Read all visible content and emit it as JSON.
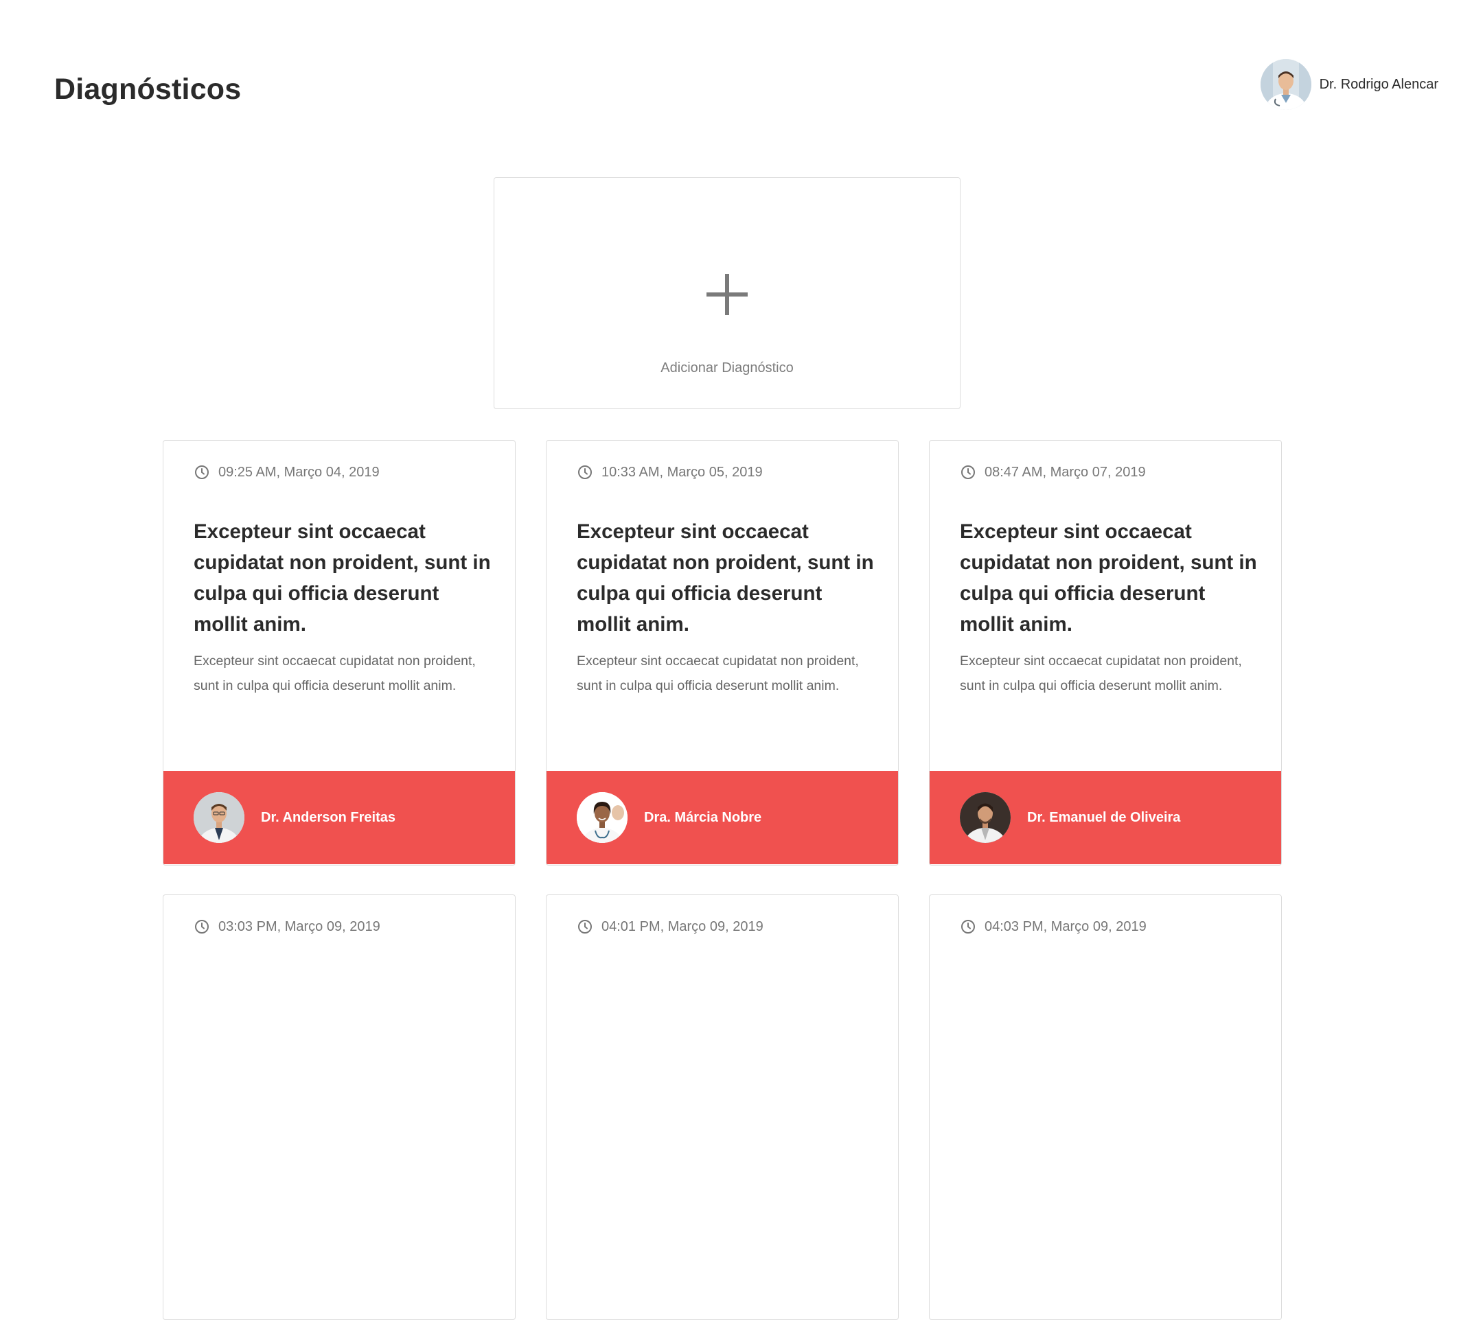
{
  "header": {
    "title": "Diagnósticos",
    "user_name": "Dr. Rodrigo Alencar",
    "user_avatar_icon": "doctor-avatar"
  },
  "add_card": {
    "label": "Adicionar Diagnóstico",
    "icon": "plus-icon"
  },
  "cards": [
    {
      "time": "09:25 AM, Março 04, 2019",
      "title": "Excepteur sint occaecat cupidatat non proident, sunt in culpa qui officia deserunt mollit anim.",
      "description": "Excepteur sint occaecat cupidatat non proident, sunt in culpa qui officia deserunt mollit anim.",
      "doctor": "Dr. Anderson Freitas"
    },
    {
      "time": "10:33 AM, Março 05, 2019",
      "title": "Excepteur sint occaecat cupidatat non proident, sunt in culpa qui officia deserunt mollit anim.",
      "description": "Excepteur sint occaecat cupidatat non proident, sunt in culpa qui officia deserunt mollit anim.",
      "doctor": "Dra. Márcia Nobre"
    },
    {
      "time": "08:47 AM, Março 07, 2019",
      "title": "Excepteur sint occaecat cupidatat non proident, sunt in culpa qui officia deserunt mollit anim.",
      "description": "Excepteur sint occaecat cupidatat non proident, sunt in culpa qui officia deserunt mollit anim.",
      "doctor": "Dr. Emanuel de Oliveira"
    },
    {
      "time": "03:03 PM, Março 09, 2019"
    },
    {
      "time": "04:01 PM, Março 09, 2019"
    },
    {
      "time": "04:03 PM, Março 09, 2019"
    }
  ],
  "colors": {
    "accent": "#f0514f",
    "border": "#dddddd",
    "title_text": "#2b2b2b",
    "muted_text": "#777777"
  }
}
